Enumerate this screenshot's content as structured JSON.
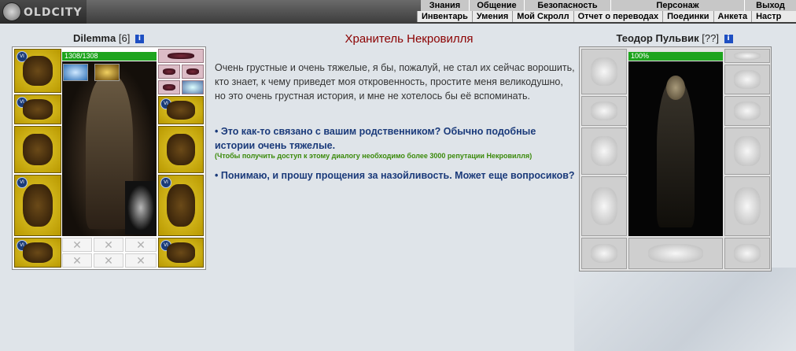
{
  "app": {
    "logo_text": "OLDCITY"
  },
  "top_menu": [
    "Знания",
    "Общение",
    "Безопасность",
    "Персонаж",
    "Выход"
  ],
  "sub_menu": [
    "Инвентарь",
    "Умения",
    "Мой Скролл",
    "Отчет о переводах",
    "Поединки",
    "Анкета",
    "Настр"
  ],
  "player": {
    "name": "Dilemma",
    "level": "[6]",
    "hp": "1308/1308",
    "info_icon": "i"
  },
  "npc": {
    "name": "Теодор Пульвик",
    "level": "[??]",
    "hp": "100%",
    "info_icon": "i"
  },
  "dialog": {
    "title": "Хранитель Некровилля",
    "text": "Очень грустные и очень тяжелые, я бы, пожалуй, не стал их сейчас ворошить, кто знает, к чему приведет моя откровенность, простите меня великодушно, но это очень грустная история, и мне не хотелось бы её вспоминать.",
    "option1": "• Это как-то связано с вашим родственником? Обычно подобные истории очень тяжелые.",
    "option1_note": "(Чтобы получить доступ к этому диалогу необходимо более 3000 репутации Некровилля)",
    "option2": "• Понимаю, и прошу прощения за назойливость. Может еще вопросиков?"
  },
  "colors": {
    "title": "#8b0000",
    "option": "#1a3a7a",
    "note": "#3a8a0a",
    "hp": "#1da41d"
  },
  "icons": {
    "badge": "VI",
    "empty_slot": "✕"
  }
}
